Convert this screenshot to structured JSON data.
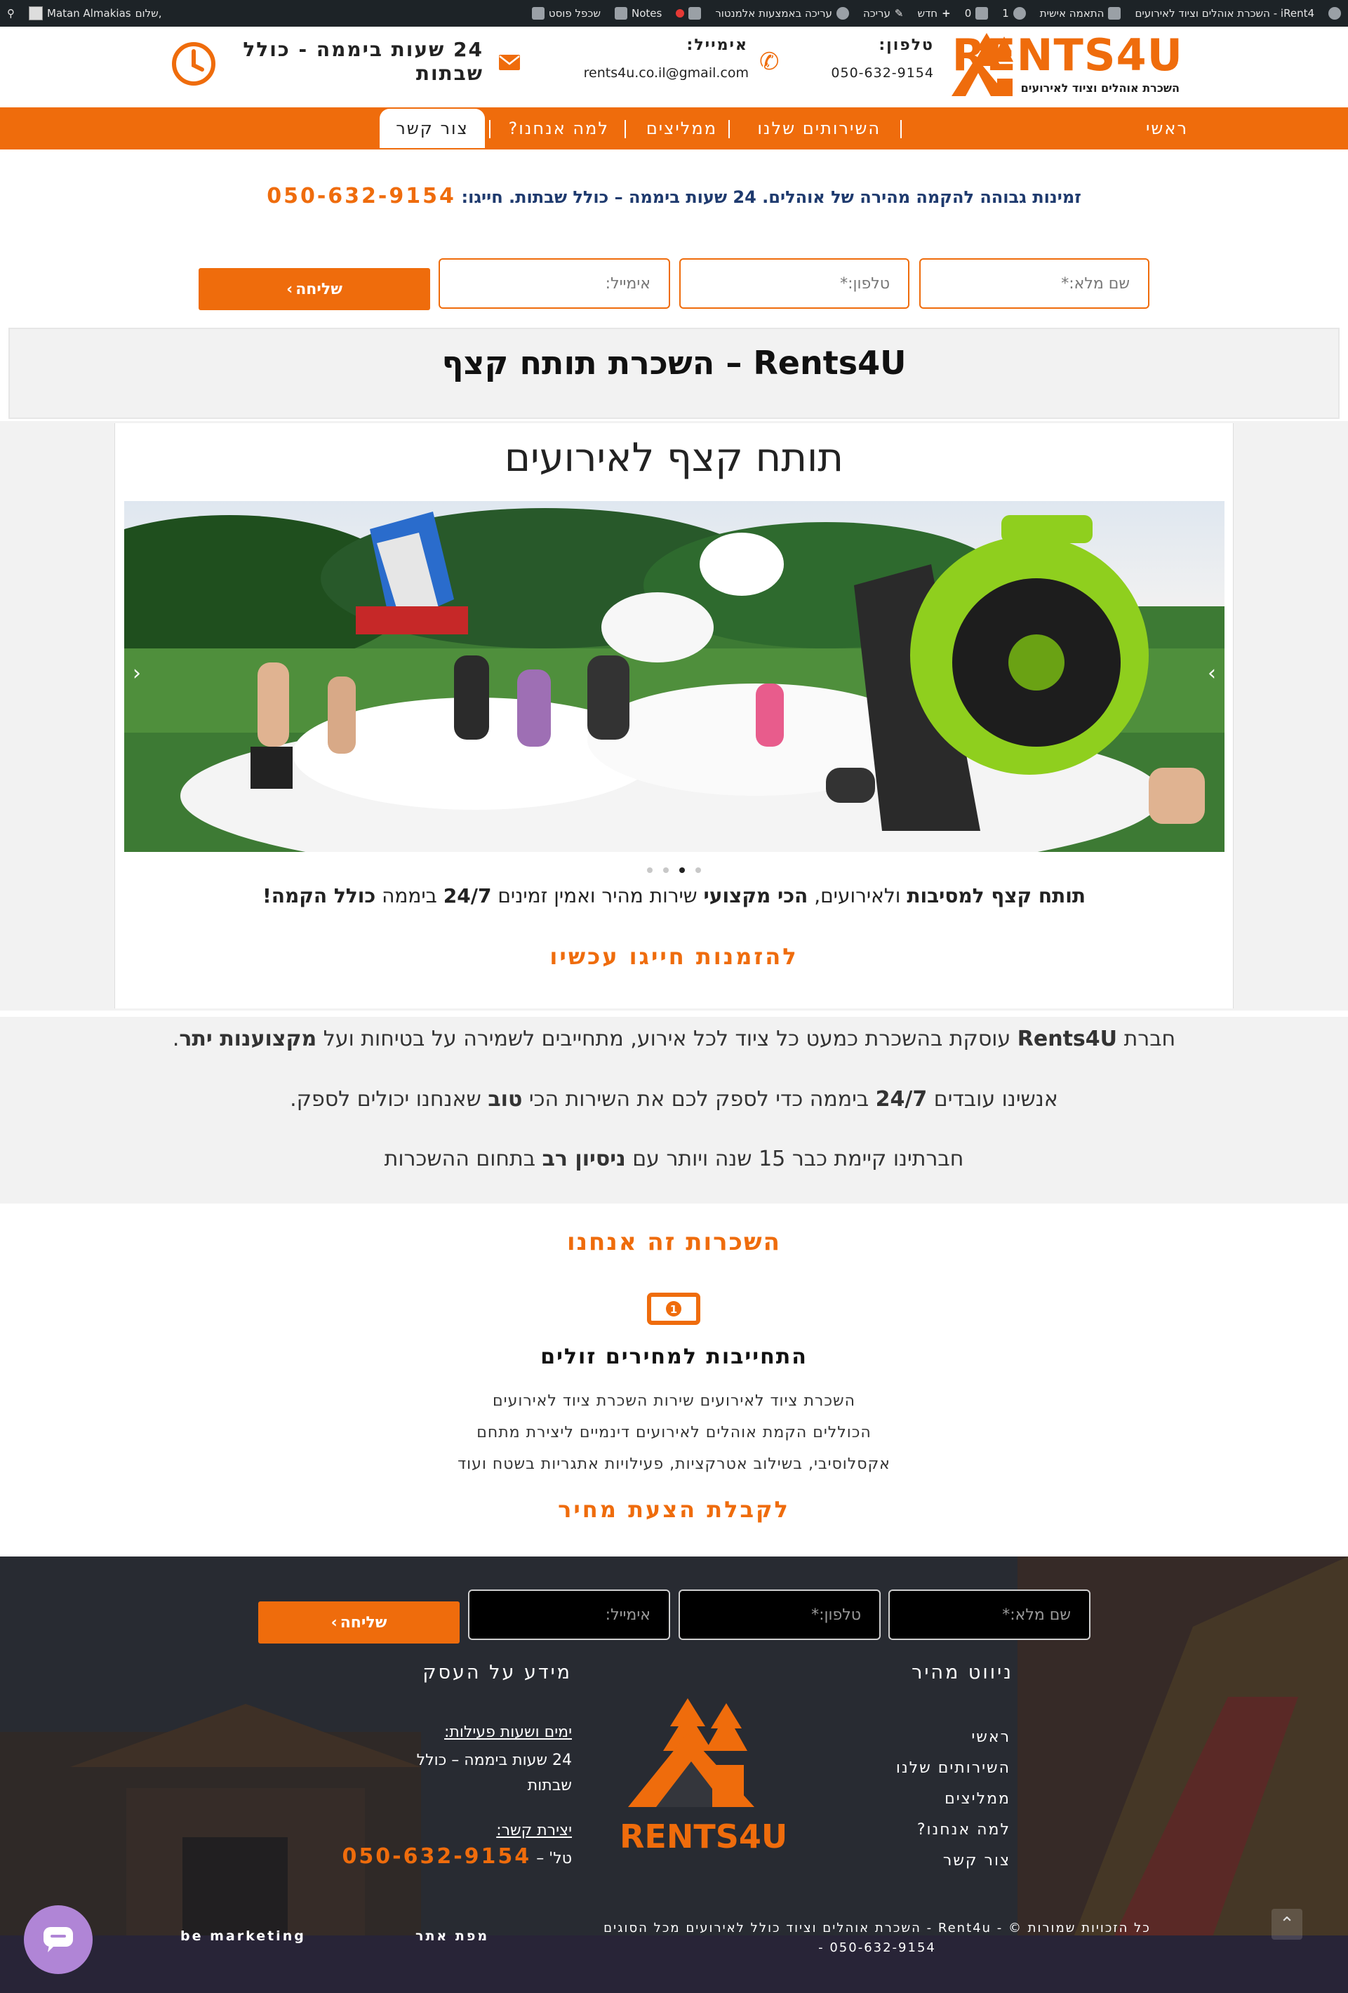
{
  "adminbar": {
    "site_name": "iRent4 - השכרת אוהלים וציוד לאירועים",
    "customize": "התאמה אישית",
    "updates_count": "1",
    "comments_count": "0",
    "new": "חדש",
    "edit": "עריכה",
    "elementor_edit": "עריכה באמצעות אלמנטור",
    "notes": "Notes",
    "duplicate": "שכפל פוסט",
    "greeting": "שלום,",
    "user": "Matan Almakias"
  },
  "header": {
    "logo_text": "RENTS4U",
    "logo_sub": "השכרת אוהלים וציוד לאירועים",
    "phone_label": "טלפון:",
    "phone_value": "050-632-9154",
    "email_label": "אימייל:",
    "email_value": "rents4u.co.il@gmail.com",
    "hours_line1": "24 שעות ביממה - כולל",
    "hours_line2": "שבתות"
  },
  "nav": {
    "items": [
      "ראשי",
      "השירותים שלנו",
      "ממליצים",
      "למה אנחנו?",
      "צור קשר"
    ]
  },
  "promo": {
    "text": "זמינות גבוהה להקמה מהירה של אוהלים. 24 שעות ביממה – כולל שבתות. חייגו:",
    "phone": "050-632-9154"
  },
  "form": {
    "name_placeholder": "שם מלא:*",
    "phone_placeholder": "טלפון:*",
    "email_placeholder": "אימייל:",
    "submit": "שליחה"
  },
  "page": {
    "title": "Rents4U – השכרת תותח קצף",
    "section_heading": "תותח קצף לאירועים",
    "desc_part1": "תותח קצף למסיבות",
    "desc_part2": " ולאירועים, ",
    "desc_part3": "הכי מקצועי",
    "desc_part4": " שירות מהיר ואמין זמינים ",
    "desc_part5": "24/7",
    "desc_part6": " ביממה ",
    "desc_part7": "כולל הקמה!",
    "cta": "להזמנות חייגו עכשיו"
  },
  "about": {
    "l1_a": "חברת ",
    "l1_b": "Rents4U",
    "l1_c": " עוסקת בהשכרת כמעט כל ציוד לכל אירוע, מתחייבים לשמירה על בטיחות ועל ",
    "l1_d": "מקצוענות יתר",
    "l1_e": ".",
    "l2_a": "אנשינו עובדים ",
    "l2_b": "24/7",
    "l2_c": " ביממה כדי לספק לכם את השירות הכי ",
    "l2_d": "טוב",
    "l2_e": " שאנחנו יכולים לספק.",
    "l3_a": "חברתינו קיימת כבר 15 שנה ויותר עם ",
    "l3_b": "ניסיון רב",
    "l3_c": " בתחום ההשכרות"
  },
  "services": {
    "heading": "השכרות זה אנחנו",
    "feature_title": "התחייבות למחירים זולים",
    "line1": "השכרת ציוד לאירועים שירות השכרת ציוד לאירועים",
    "line2": "הכוללים הקמת אוהלים לאירועים דינמיים ליצירת מתחם",
    "line3": "אקסלוסיבי, בשילוב אטרקציות, פעילויות אתגריות בשטח ועוד",
    "cta": "לקבלת הצעת מחיר"
  },
  "footer": {
    "quicknav_title": "ניווט מהיר",
    "quicknav": [
      "ראשי",
      "השירותים שלנו",
      "ממליצים",
      "למה אנחנו?",
      "צור קשר"
    ],
    "info_title": "מידע על העסק",
    "hours_label": "ימים ושעות פעילות:",
    "hours_line1": "24 שעות ביממה – כולל",
    "hours_line2": "שבתות",
    "contact_label": "יצירת קשר:",
    "tel_prefix": "טל' –",
    "tel": "050-632-9154",
    "logo_text": "RENTS4U",
    "copyright1": "כל הזכויות שמורות © - Rent4u - השכרת אוהלים וציוד כולל לאירועים מכל הסוגים",
    "copyright2": "050-632-9154 -",
    "sitemap": "מפת אתר",
    "credit": "be marketing"
  },
  "colors": {
    "brand_orange": "#ef6c0c",
    "adminbar": "#1d2327",
    "chat_bubble": "#b085d6"
  }
}
